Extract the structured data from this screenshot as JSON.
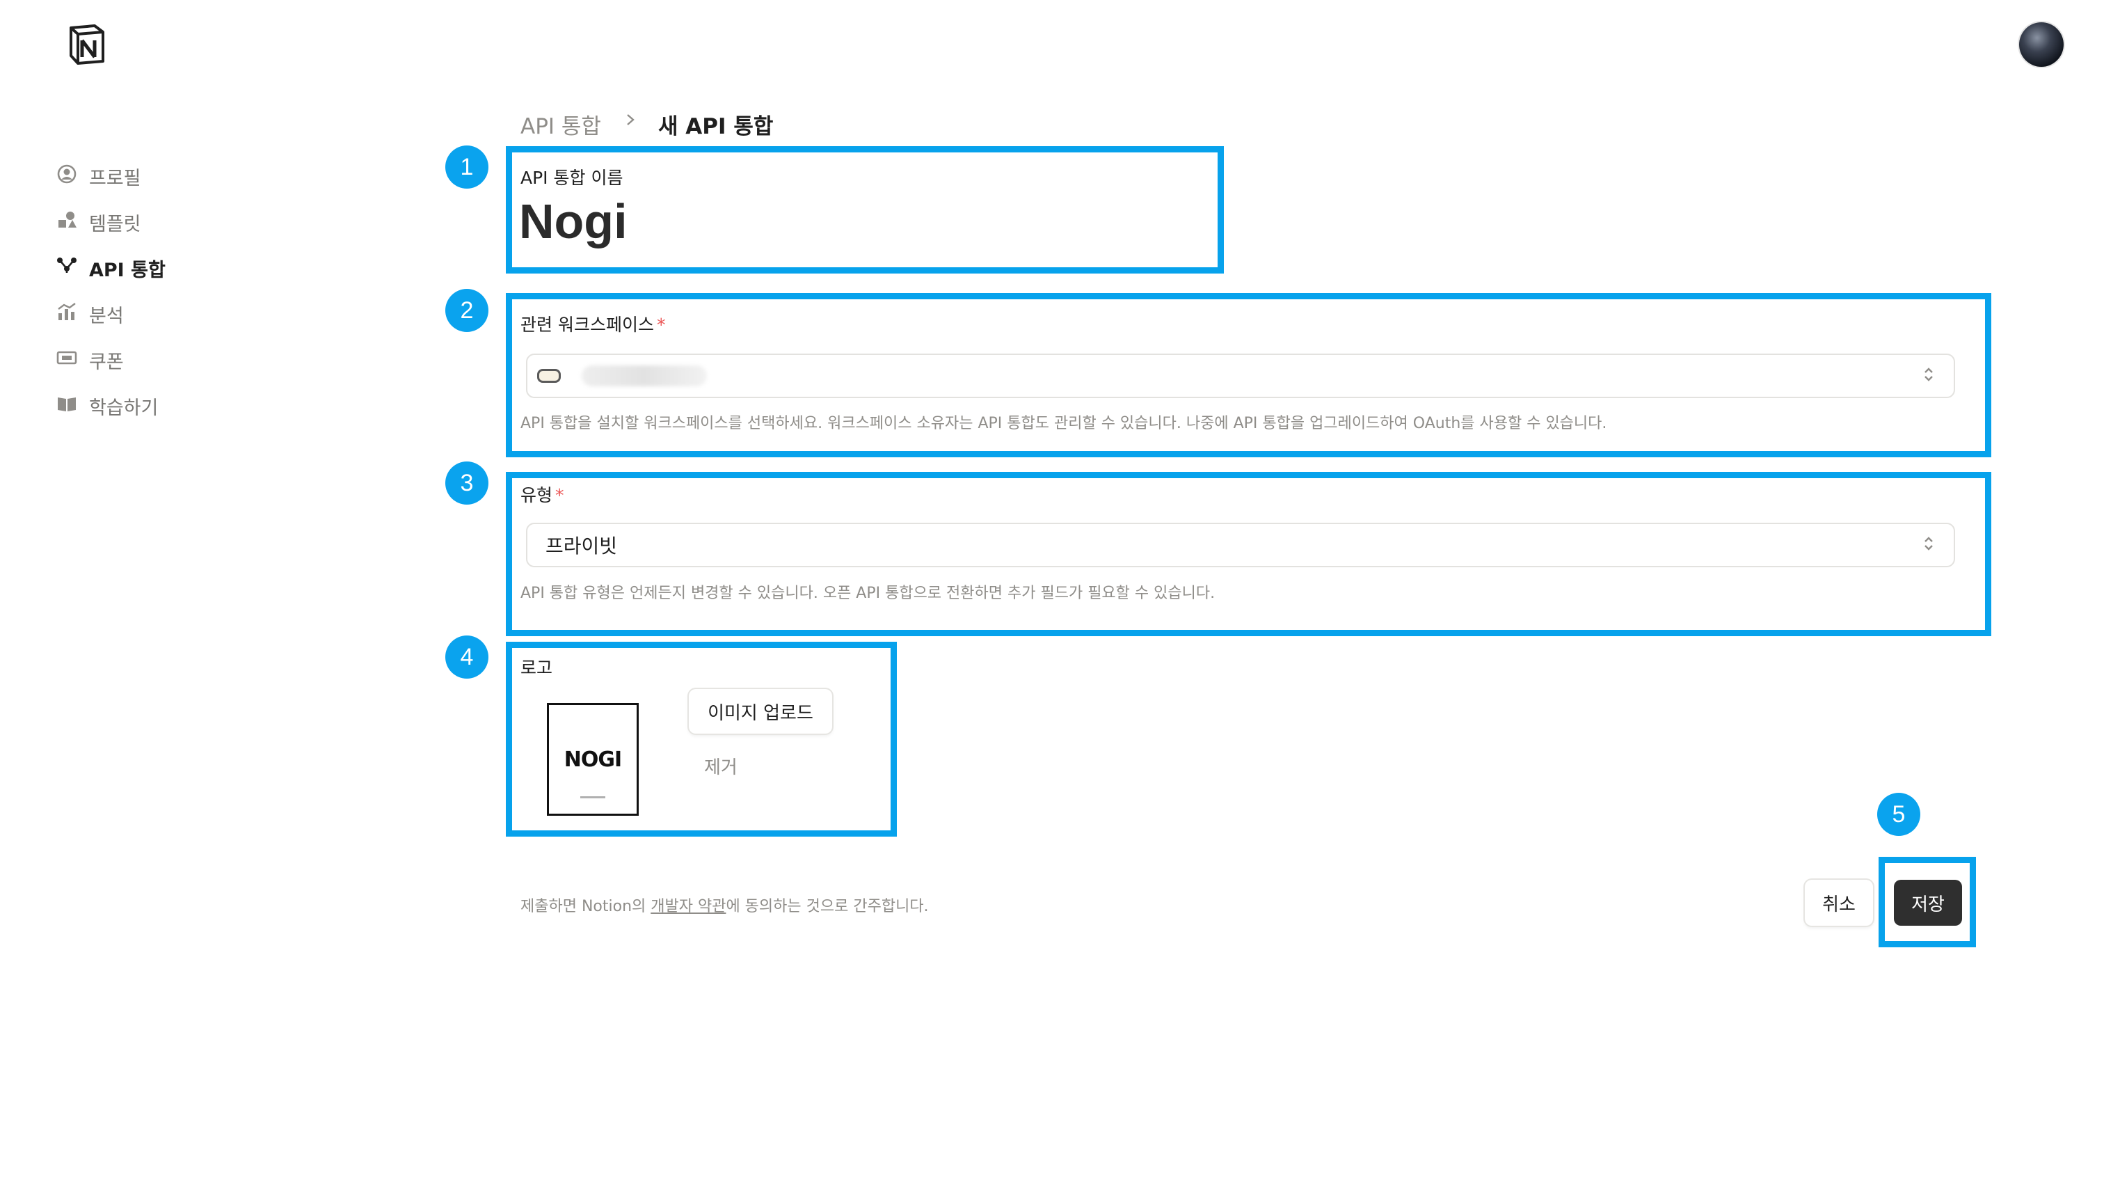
{
  "sidebar": {
    "items": [
      {
        "label": "프로필",
        "icon": "profile-icon"
      },
      {
        "label": "템플릿",
        "icon": "templates-icon"
      },
      {
        "label": "API 통합",
        "icon": "integrations-icon",
        "active": true
      },
      {
        "label": "분석",
        "icon": "analytics-icon"
      },
      {
        "label": "쿠폰",
        "icon": "coupon-icon"
      },
      {
        "label": "학습하기",
        "icon": "book-icon"
      }
    ]
  },
  "breadcrumb": {
    "parent": "API 통합",
    "separator": ">",
    "current": "새 API 통합"
  },
  "steps": [
    "1",
    "2",
    "3",
    "4",
    "5"
  ],
  "name_field": {
    "label": "API 통합 이름",
    "value": "Nogi"
  },
  "workspace_field": {
    "label": "관련 워크스페이스",
    "required_mark": "*",
    "help": "API 통합을 설치할 워크스페이스를 선택하세요. 워크스페이스 소유자는 API 통합도 관리할 수 있습니다. 나중에 API 통합을 업그레이드하여 OAuth를 사용할 수 있습니다."
  },
  "type_field": {
    "label": "유형",
    "required_mark": "*",
    "value": "프라이빗",
    "help": "API 통합 유형은 언제든지 변경할 수 있습니다. 오픈 API 통합으로 전환하면 추가 필드가 필요할 수 있습니다."
  },
  "logo_field": {
    "label": "로고",
    "logo_text": "NOGI",
    "upload_label": "이미지 업로드",
    "remove_label": "제거"
  },
  "footer": {
    "terms_prefix": "제출하면 Notion의 ",
    "terms_link": "개발자 약관",
    "terms_suffix": "에 동의하는 것으로 간주합니다.",
    "cancel_label": "취소",
    "save_label": "저장"
  },
  "colors": {
    "highlight": "#07a2ec",
    "badge": "#0aa3ee",
    "required": "#eb5757",
    "primary_button": "#2f2f2f"
  }
}
